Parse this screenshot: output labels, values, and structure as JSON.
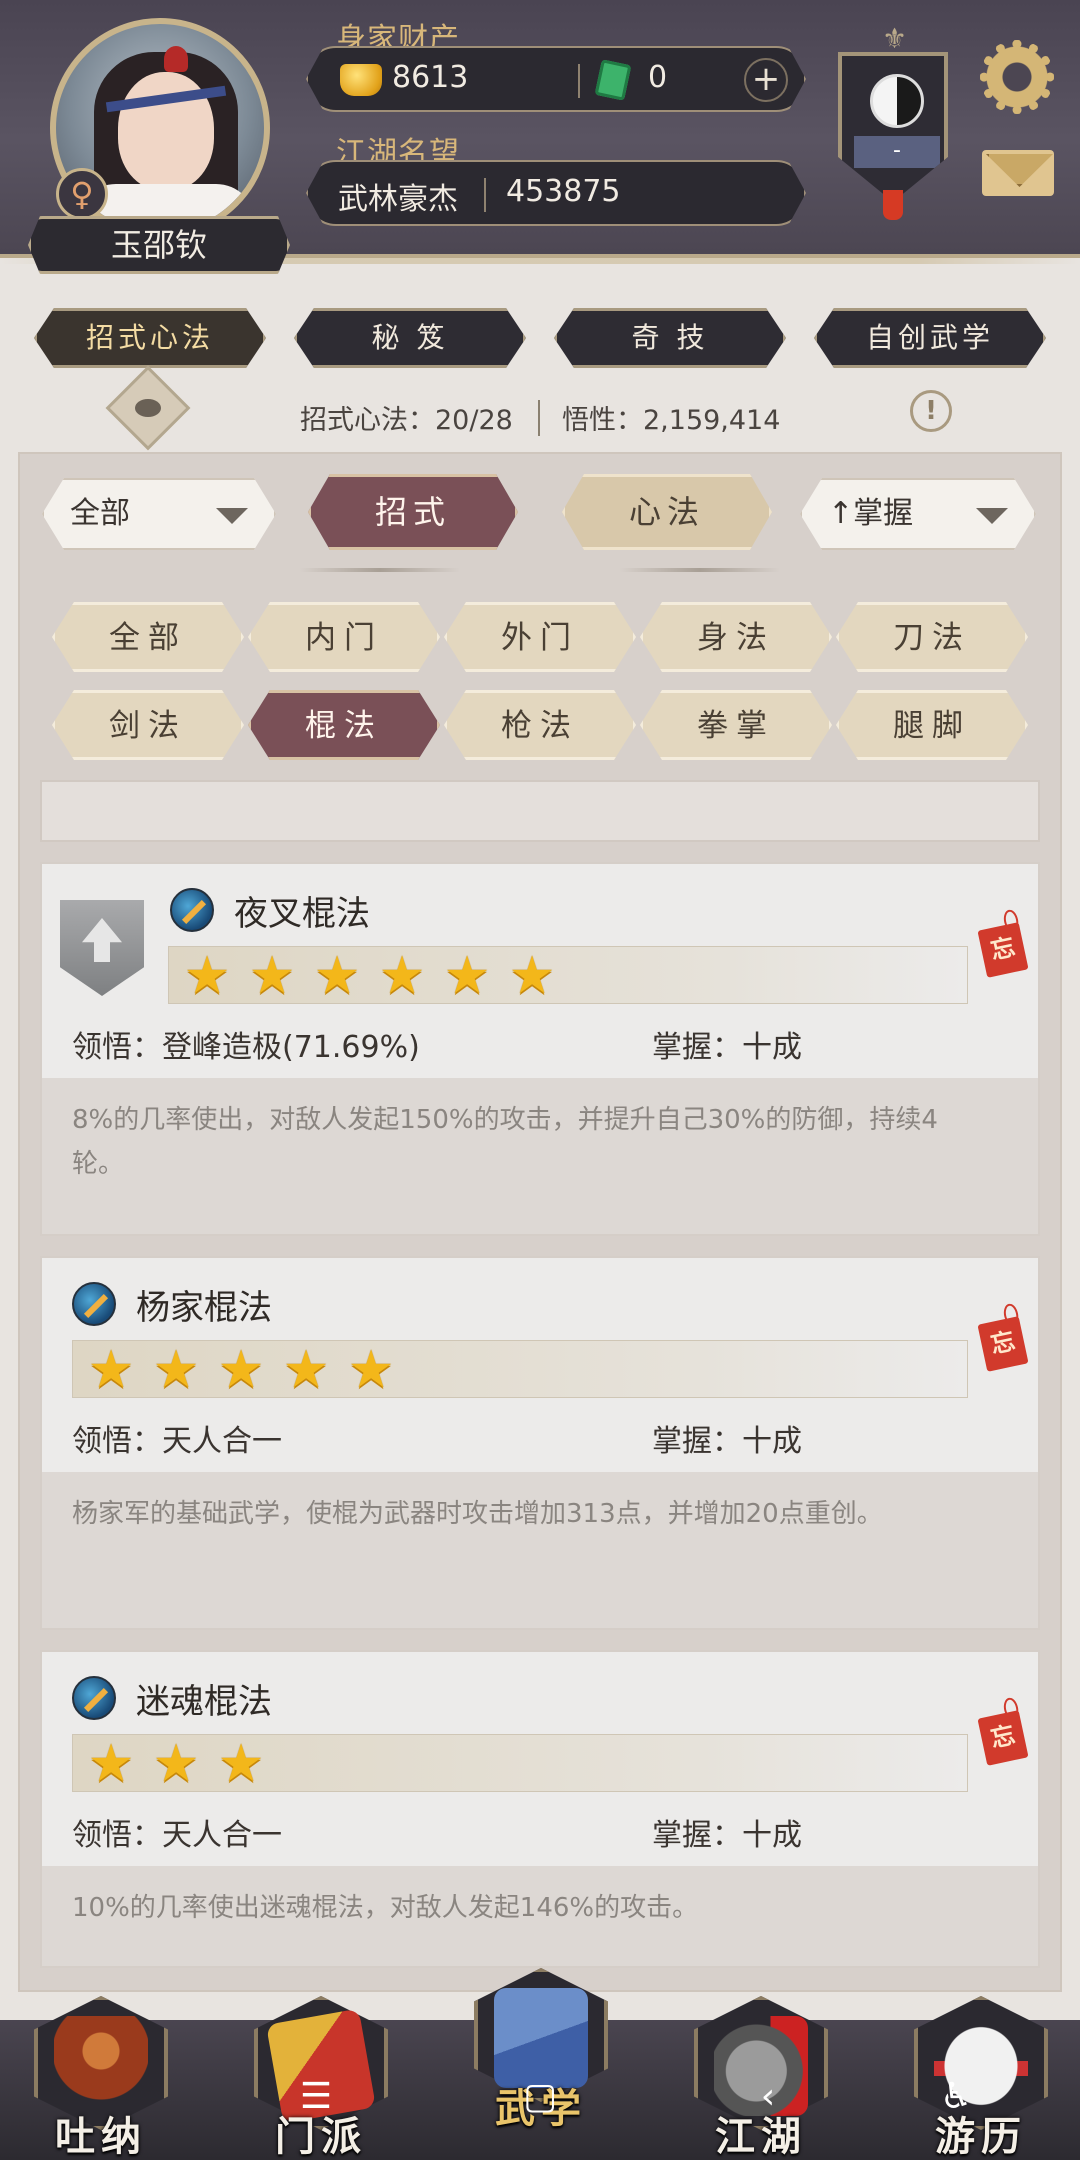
{
  "profile": {
    "name": "玉邵钦",
    "gender_symbol": "♀",
    "wealth_label": "身家财产",
    "gold": "8613",
    "jade": "0",
    "plus": "+",
    "fame_label": "江湖名望",
    "fame_title": "武林豪杰",
    "fame_value": "453875",
    "sect_value": "-"
  },
  "category_tabs": [
    {
      "label": "招式心法",
      "active": true
    },
    {
      "label": "秘 笈",
      "active": false
    },
    {
      "label": "奇 技",
      "active": false
    },
    {
      "label": "自创武学",
      "active": false
    }
  ],
  "stats": {
    "learned": "招式心法：20/28",
    "insight": "悟性：2,159,414",
    "info": "!"
  },
  "filters": {
    "scope_dropdown": "全部",
    "mode_on": "招式",
    "mode_off": "心法",
    "sort_dropdown": "↑掌握",
    "types": [
      {
        "label": "全部",
        "active": false
      },
      {
        "label": "内门",
        "active": false
      },
      {
        "label": "外门",
        "active": false
      },
      {
        "label": "身法",
        "active": false
      },
      {
        "label": "刀法",
        "active": false
      },
      {
        "label": "剑法",
        "active": false
      },
      {
        "label": "棍法",
        "active": true
      },
      {
        "label": "枪法",
        "active": false
      },
      {
        "label": "拳掌",
        "active": false
      },
      {
        "label": "腿脚",
        "active": false
      }
    ]
  },
  "skills": [
    {
      "name": "夜叉棍法",
      "stars": 6,
      "comprehension": "领悟：登峰造极(71.69%)",
      "mastery": "掌握：十成",
      "description": "8%的几率使出，对敌人发起150%的攻击，并提升自己30%的防御，持续4轮。",
      "forget": "忘"
    },
    {
      "name": "杨家棍法",
      "stars": 5,
      "comprehension": "领悟：天人合一",
      "mastery": "掌握：十成",
      "description": "杨家军的基础武学，使棍为武器时攻击增加313点，并增加20点重创。",
      "forget": "忘"
    },
    {
      "name": "迷魂棍法",
      "stars": 3,
      "comprehension": "领悟：天人合一",
      "mastery": "掌握：十成",
      "description": "10%的几率使出迷魂棍法，对敌人发起146%的攻击。",
      "forget": "忘"
    }
  ],
  "bottom_nav": [
    {
      "label": "吐纳",
      "icon": "meditation-icon",
      "active": false
    },
    {
      "label": "门派",
      "icon": "sect-banner-icon",
      "active": false
    },
    {
      "label": "武学",
      "icon": "martial-book-icon",
      "active": true
    },
    {
      "label": "江湖",
      "icon": "bamboo-hat-icon",
      "active": false
    },
    {
      "label": "游历",
      "icon": "horse-icon",
      "active": false
    }
  ],
  "system_nav": {
    "menu": "☰",
    "home": "▢",
    "back": "‹",
    "accessibility": "♿"
  },
  "colors": {
    "accent_active": "#7a5057",
    "gold_text": "#d8b77a",
    "star": "#f3b71a",
    "stamp": "#d13a2c"
  }
}
